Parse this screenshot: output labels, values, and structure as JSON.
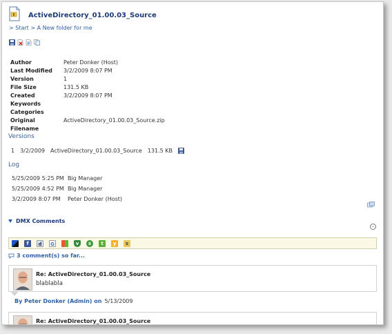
{
  "document": {
    "title": "ActiveDirectory_01.00.03_Source",
    "breadcrumb": [
      {
        "label": "> Start"
      },
      {
        "label": "> A New folder for me"
      }
    ]
  },
  "toolbar": {
    "icons": [
      "save-icon",
      "delete-icon",
      "document-icon",
      "copy-icon"
    ]
  },
  "properties": [
    {
      "label": "Author",
      "value": "Peter Donker (Host)"
    },
    {
      "label": "Last Modified",
      "value": "3/2/2009 8:07 PM"
    },
    {
      "label": "Version",
      "value": "1"
    },
    {
      "label": "File Size",
      "value": "131.5 KB"
    },
    {
      "label": "Created",
      "value": "3/2/2009 8:07 PM"
    },
    {
      "label": "Keywords",
      "value": ""
    },
    {
      "label": "Categories",
      "value": ""
    },
    {
      "label": "Original Filename",
      "value": "ActiveDirectory_01.00.03_Source.zip"
    }
  ],
  "versions": {
    "heading": "Versions",
    "rows": [
      {
        "number": "1",
        "date": "3/2/2009",
        "name": "ActiveDirectory_01.00.03_Source",
        "size": "131.5 KB"
      }
    ]
  },
  "log": {
    "heading": "Log",
    "rows": [
      {
        "date": "5/25/2009 5:25 PM",
        "user": "Big Manager"
      },
      {
        "date": "5/25/2009 4:52 PM",
        "user": "Big Manager"
      },
      {
        "date": "3/2/2009 8:07 PM",
        "user": "Peter Donker (Host)"
      }
    ]
  },
  "comments": {
    "heading": "DMX Comments",
    "count_text": "3 comment(s) so far...",
    "share_icons": [
      "delicious-icon",
      "facebook-icon",
      "digg-icon",
      "google-icon",
      "windows-live-icon",
      "shield-icon",
      "stumbleupon-icon",
      "technorati-icon",
      "yahoo-icon",
      "spurl-icon"
    ],
    "items": [
      {
        "title": "Re: ActiveDirectory_01.00.03_Source",
        "body": "blablabla",
        "author": "By Peter Donker (Admin) on",
        "date": "5/13/2009"
      },
      {
        "title": "Re: ActiveDirectory_01.00.03_Source",
        "body": "",
        "author": "",
        "date": ""
      }
    ]
  },
  "colors": {
    "accent": "#2f5fa7",
    "title": "#1d3a78",
    "share_bar": "#fbf9e6"
  }
}
